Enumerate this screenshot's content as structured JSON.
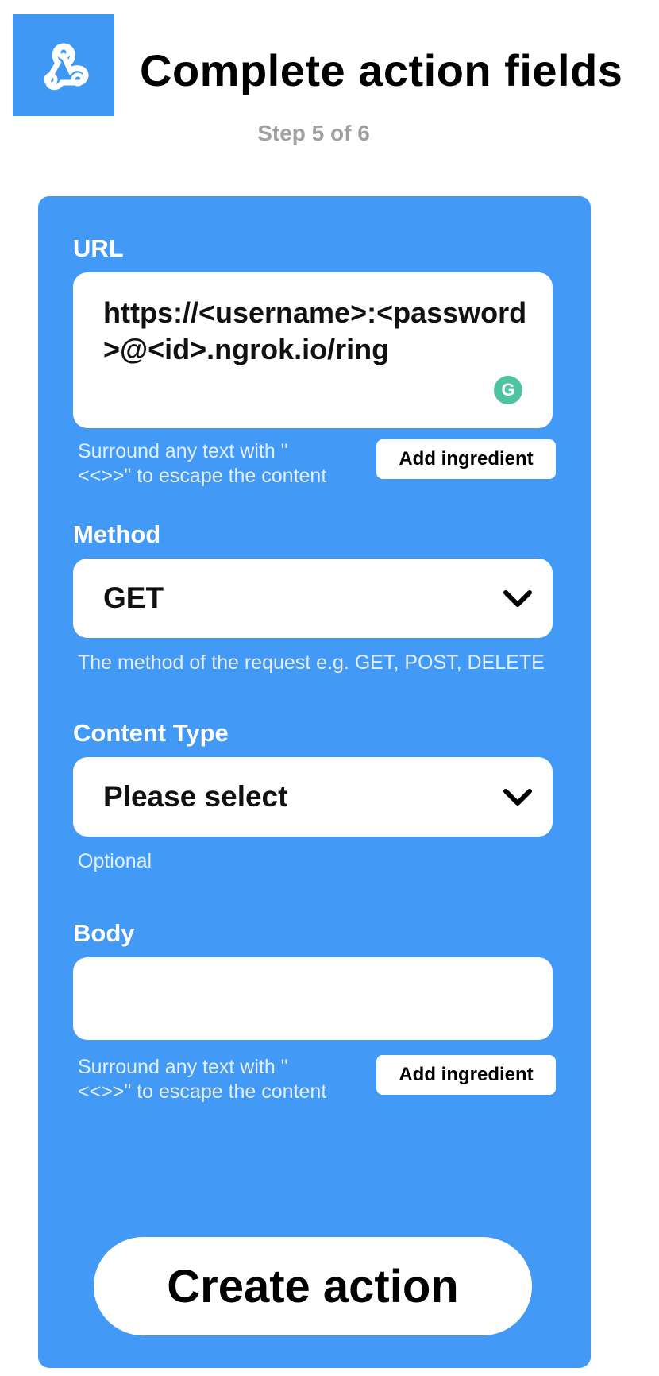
{
  "header": {
    "logo_icon": "webhook-icon",
    "logo_color": "#3f98f3",
    "title": "Complete action fields",
    "step": "Step 5 of 6"
  },
  "form": {
    "card_color": "#4399f6",
    "url": {
      "label": "URL",
      "value": "https://<username>:<password>@<id>.ngrok.io/ring",
      "grammarly_icon": "G",
      "helper_line1": "Surround any text with \"",
      "helper_line2": "<<>>\" to escape the content",
      "add_ingredient": "Add ingredient"
    },
    "method": {
      "label": "Method",
      "selected": "GET",
      "helper": "The method of the request e.g. GET, POST, DELETE"
    },
    "content_type": {
      "label": "Content Type",
      "selected": "Please select",
      "helper": "Optional"
    },
    "body": {
      "label": "Body",
      "value": "",
      "helper_line1": "Surround any text with \"",
      "helper_line2": "<<>>\" to escape the content",
      "add_ingredient": "Add ingredient"
    },
    "submit_label": "Create action"
  }
}
